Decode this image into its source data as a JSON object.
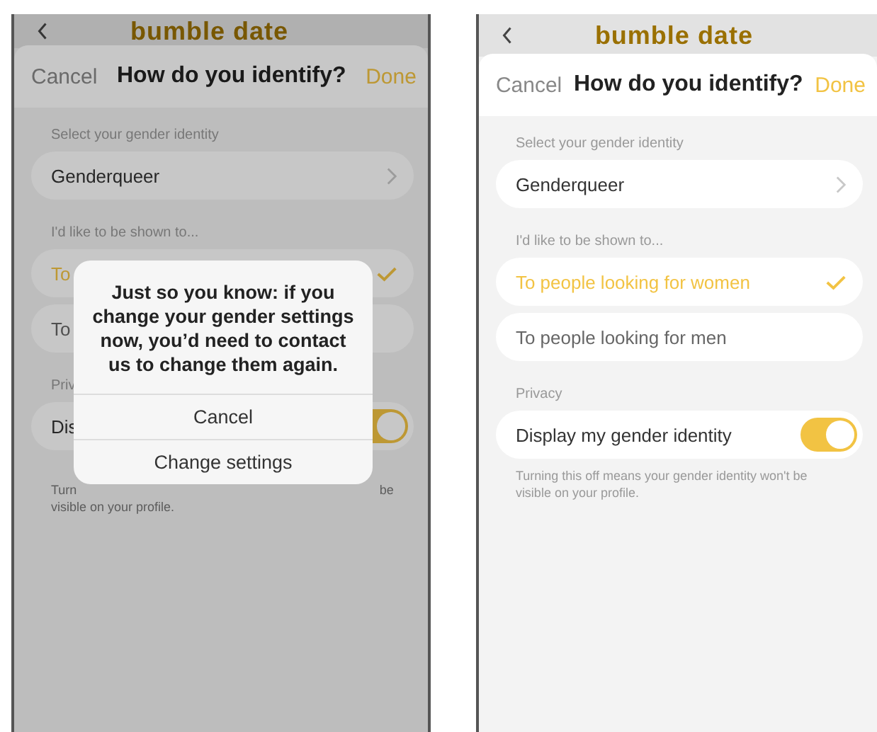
{
  "screens": [
    {
      "dimmed": true,
      "logo": "bumble date",
      "nav": {
        "cancel": "Cancel",
        "title": "How do you identify?",
        "done": "Done"
      },
      "identity_label": "Select your gender identity",
      "identity_value": "Genderqueer",
      "shown_label": "I'd like to be shown to...",
      "options": [
        {
          "label": "To",
          "selected": true
        },
        {
          "label": "To",
          "selected": false
        }
      ],
      "privacy_label": "Priv",
      "toggle": {
        "label": "Dis",
        "on": true
      },
      "footnote": [
        "Turn",
        "be",
        "visible on your profile."
      ],
      "alert": {
        "message": "Just so you know: if you change your gender settings now, you’d need to contact us to change them again.",
        "buttons": [
          "Cancel",
          "Change settings"
        ]
      }
    },
    {
      "dimmed": false,
      "logo": "bumble date",
      "nav": {
        "cancel": "Cancel",
        "title": "How do you identify?",
        "done": "Done"
      },
      "identity_label": "Select your gender identity",
      "identity_value": "Genderqueer",
      "shown_label": "I'd like to be shown to...",
      "options": [
        {
          "label": "To people looking for women",
          "selected": true
        },
        {
          "label": "To people looking for men",
          "selected": false
        }
      ],
      "privacy_label": "Privacy",
      "toggle": {
        "label": "Display my gender identity",
        "on": true
      },
      "footnote": [
        "Turning this off means your gender identity won't be visible on your profile."
      ]
    }
  ]
}
